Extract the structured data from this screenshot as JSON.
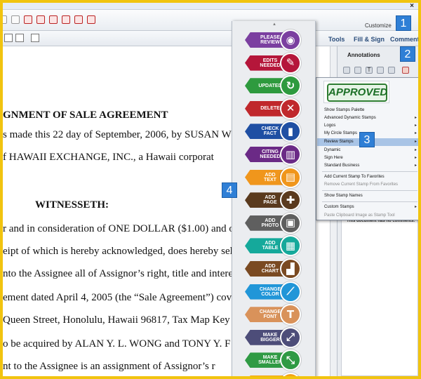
{
  "toolbar": {
    "customize_label": "Customize",
    "close_glyph": "×"
  },
  "nav_tabs": {
    "tools": "Tools",
    "fill_sign": "Fill & Sign",
    "comment": "Comment"
  },
  "document": {
    "lines": [
      "GNMENT OF SALE AGREEMENT",
      "s made this 22 day of September, 2006, by SUSAN W",
      "f  HAWAII  EXCHANGE,  INC.,  a  Hawaii  corporat",
      "WITNESSETH:",
      "r and in consideration of ONE DOLLAR ($1.00) and ot",
      "eipt of which is hereby acknowledged, does hereby sel",
      "nto the Assignee all of Assignor’s right, title and interest",
      "ement dated April 4, 2005 (the “Sale Agreement”) cove",
      "Queen Street, Honolulu, Hawaii 96817, Tax Map Key No",
      "o be acquired by ALAN Y. L. WONG and TONY Y. F",
      "nt  to  the  Assignee  is  an  assignment  of  Assignor’s  r"
    ]
  },
  "annotations_panel": {
    "header": "Annotations",
    "no_comments": "This document has no comments."
  },
  "stamp_menu": {
    "preview_stamp": "APPROVED",
    "items": [
      {
        "label": "Show Stamps Palette",
        "submenu": false
      },
      {
        "label": "Advanced Dynamic Stamps",
        "submenu": true
      },
      {
        "label": "Logos",
        "submenu": true
      },
      {
        "label": "My Circle Stamps",
        "submenu": true
      },
      {
        "label": "Review Stamps",
        "submenu": true
      },
      {
        "label": "Dynamic",
        "submenu": true
      },
      {
        "label": "Sign Here",
        "submenu": true
      },
      {
        "label": "Standard Business",
        "submenu": true
      },
      {
        "label": "Add Current Stamp To Favorites",
        "submenu": false
      },
      {
        "label": "Remove Current Stamp From Favorites",
        "submenu": false
      },
      {
        "label": "Show Stamp Names",
        "submenu": false
      },
      {
        "label": "Custom Stamps",
        "submenu": true
      },
      {
        "label": "Paste Clipboard Image as Stamp Tool",
        "submenu": false
      }
    ],
    "submenu_arrow": "▸"
  },
  "stamps": [
    {
      "label": "PLEASE\nREVIEW",
      "color": "#7b3fa0",
      "icon": "eye-icon"
    },
    {
      "label": "EDITS\nNEEDED",
      "color": "#b5163a",
      "icon": "pencil-icon"
    },
    {
      "label": "UPDATED",
      "color": "#2e9a3e",
      "icon": "refresh-icon"
    },
    {
      "label": "DELETE",
      "color": "#c0282c",
      "icon": "x-icon"
    },
    {
      "label": "CHECK\nFACT",
      "color": "#1f4fa3",
      "icon": "book-icon"
    },
    {
      "label": "CITING\nNEEDED",
      "color": "#6b2a86",
      "icon": "library-icon"
    },
    {
      "label": "ADD\nTEXT",
      "color": "#f0961c",
      "icon": "document-icon"
    },
    {
      "label": "ADD\nPAGE",
      "color": "#5a3a1e",
      "icon": "add-page-icon"
    },
    {
      "label": "ADD\nPHOTO",
      "color": "#5f5f5f",
      "icon": "photo-icon"
    },
    {
      "label": "ADD\nTABLE",
      "color": "#15a99b",
      "icon": "table-icon"
    },
    {
      "label": "ADD\nCHART",
      "color": "#7a4a22",
      "icon": "chart-icon"
    },
    {
      "label": "CHANGE\nCOLOR",
      "color": "#2196d8",
      "icon": "brush-icon"
    },
    {
      "label": "CHANGE\nFONT",
      "color": "#d9925a",
      "icon": "font-icon"
    },
    {
      "label": "MAKE\nBIGGER",
      "color": "#4d4d79",
      "icon": "enlarge-icon"
    },
    {
      "label": "MAKE\nSMALLER",
      "color": "#2f9a44",
      "icon": "shrink-icon"
    },
    {
      "label": "MOVE\nUP",
      "color": "#f3a21a",
      "icon": "arrow-up-icon"
    }
  ],
  "badges": [
    "1",
    "2",
    "3",
    "4"
  ]
}
